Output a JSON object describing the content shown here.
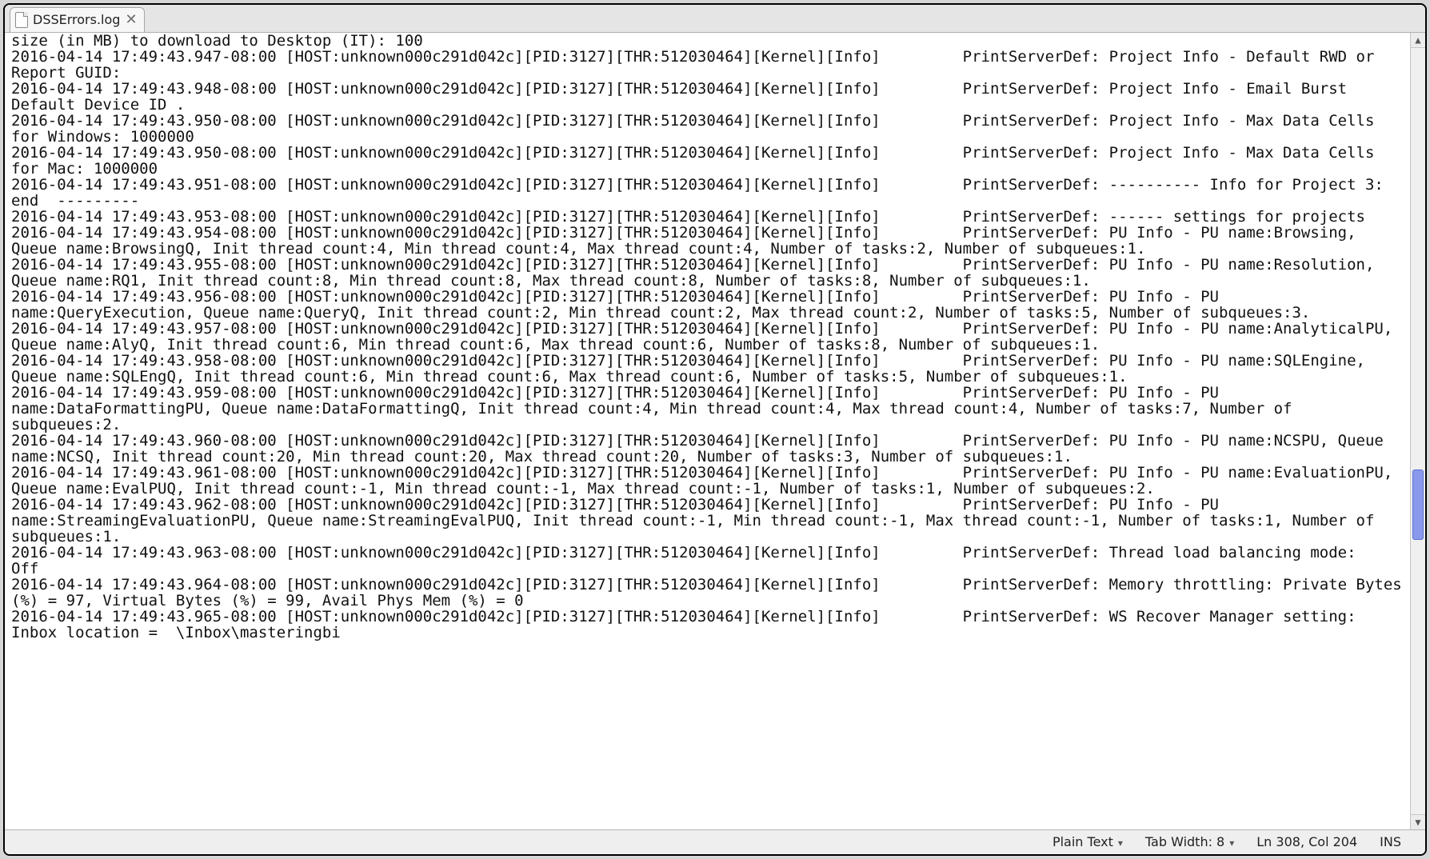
{
  "tab": {
    "label": "DSSErrors.log"
  },
  "log_text": "size (in MB) to download to Desktop (IT): 100\n2016-04-14 17:49:43.947-08:00 [HOST:unknown000c291d042c][PID:3127][THR:512030464][Kernel][Info]         PrintServerDef: Project Info - Default RWD or Report GUID: \n2016-04-14 17:49:43.948-08:00 [HOST:unknown000c291d042c][PID:3127][THR:512030464][Kernel][Info]         PrintServerDef: Project Info - Email Burst Default Device ID .\n2016-04-14 17:49:43.950-08:00 [HOST:unknown000c291d042c][PID:3127][THR:512030464][Kernel][Info]         PrintServerDef: Project Info - Max Data Cells for Windows: 1000000\n2016-04-14 17:49:43.950-08:00 [HOST:unknown000c291d042c][PID:3127][THR:512030464][Kernel][Info]         PrintServerDef: Project Info - Max Data Cells for Mac: 1000000\n2016-04-14 17:49:43.951-08:00 [HOST:unknown000c291d042c][PID:3127][THR:512030464][Kernel][Info]         PrintServerDef: ---------- Info for Project 3: end  ---------\n2016-04-14 17:49:43.953-08:00 [HOST:unknown000c291d042c][PID:3127][THR:512030464][Kernel][Info]         PrintServerDef: ------ settings for projects\n2016-04-14 17:49:43.954-08:00 [HOST:unknown000c291d042c][PID:3127][THR:512030464][Kernel][Info]         PrintServerDef: PU Info - PU name:Browsing, Queue name:BrowsingQ, Init thread count:4, Min thread count:4, Max thread count:4, Number of tasks:2, Number of subqueues:1.\n2016-04-14 17:49:43.955-08:00 [HOST:unknown000c291d042c][PID:3127][THR:512030464][Kernel][Info]         PrintServerDef: PU Info - PU name:Resolution, Queue name:RQ1, Init thread count:8, Min thread count:8, Max thread count:8, Number of tasks:8, Number of subqueues:1.\n2016-04-14 17:49:43.956-08:00 [HOST:unknown000c291d042c][PID:3127][THR:512030464][Kernel][Info]         PrintServerDef: PU Info - PU name:QueryExecution, Queue name:QueryQ, Init thread count:2, Min thread count:2, Max thread count:2, Number of tasks:5, Number of subqueues:3.\n2016-04-14 17:49:43.957-08:00 [HOST:unknown000c291d042c][PID:3127][THR:512030464][Kernel][Info]         PrintServerDef: PU Info - PU name:AnalyticalPU, Queue name:AlyQ, Init thread count:6, Min thread count:6, Max thread count:6, Number of tasks:8, Number of subqueues:1.\n2016-04-14 17:49:43.958-08:00 [HOST:unknown000c291d042c][PID:3127][THR:512030464][Kernel][Info]         PrintServerDef: PU Info - PU name:SQLEngine, Queue name:SQLEngQ, Init thread count:6, Min thread count:6, Max thread count:6, Number of tasks:5, Number of subqueues:1.\n2016-04-14 17:49:43.959-08:00 [HOST:unknown000c291d042c][PID:3127][THR:512030464][Kernel][Info]         PrintServerDef: PU Info - PU name:DataFormattingPU, Queue name:DataFormattingQ, Init thread count:4, Min thread count:4, Max thread count:4, Number of tasks:7, Number of subqueues:2.\n2016-04-14 17:49:43.960-08:00 [HOST:unknown000c291d042c][PID:3127][THR:512030464][Kernel][Info]         PrintServerDef: PU Info - PU name:NCSPU, Queue name:NCSQ, Init thread count:20, Min thread count:20, Max thread count:20, Number of tasks:3, Number of subqueues:1.\n2016-04-14 17:49:43.961-08:00 [HOST:unknown000c291d042c][PID:3127][THR:512030464][Kernel][Info]         PrintServerDef: PU Info - PU name:EvaluationPU, Queue name:EvalPUQ, Init thread count:-1, Min thread count:-1, Max thread count:-1, Number of tasks:1, Number of subqueues:2.\n2016-04-14 17:49:43.962-08:00 [HOST:unknown000c291d042c][PID:3127][THR:512030464][Kernel][Info]         PrintServerDef: PU Info - PU name:StreamingEvaluationPU, Queue name:StreamingEvalPUQ, Init thread count:-1, Min thread count:-1, Max thread count:-1, Number of tasks:1, Number of subqueues:1.\n2016-04-14 17:49:43.963-08:00 [HOST:unknown000c291d042c][PID:3127][THR:512030464][Kernel][Info]         PrintServerDef: Thread load balancing mode:   Off\n2016-04-14 17:49:43.964-08:00 [HOST:unknown000c291d042c][PID:3127][THR:512030464][Kernel][Info]         PrintServerDef: Memory throttling: Private Bytes (%) = 97, Virtual Bytes (%) = 99, Avail Phys Mem (%) = 0\n2016-04-14 17:49:43.965-08:00 [HOST:unknown000c291d042c][PID:3127][THR:512030464][Kernel][Info]         PrintServerDef: WS Recover Manager setting: Inbox location =  \\Inbox\\masteringbi",
  "status": {
    "language": "Plain Text",
    "tab_width": "Tab Width: 8",
    "position": "Ln 308, Col 204",
    "insert_mode": "INS"
  }
}
